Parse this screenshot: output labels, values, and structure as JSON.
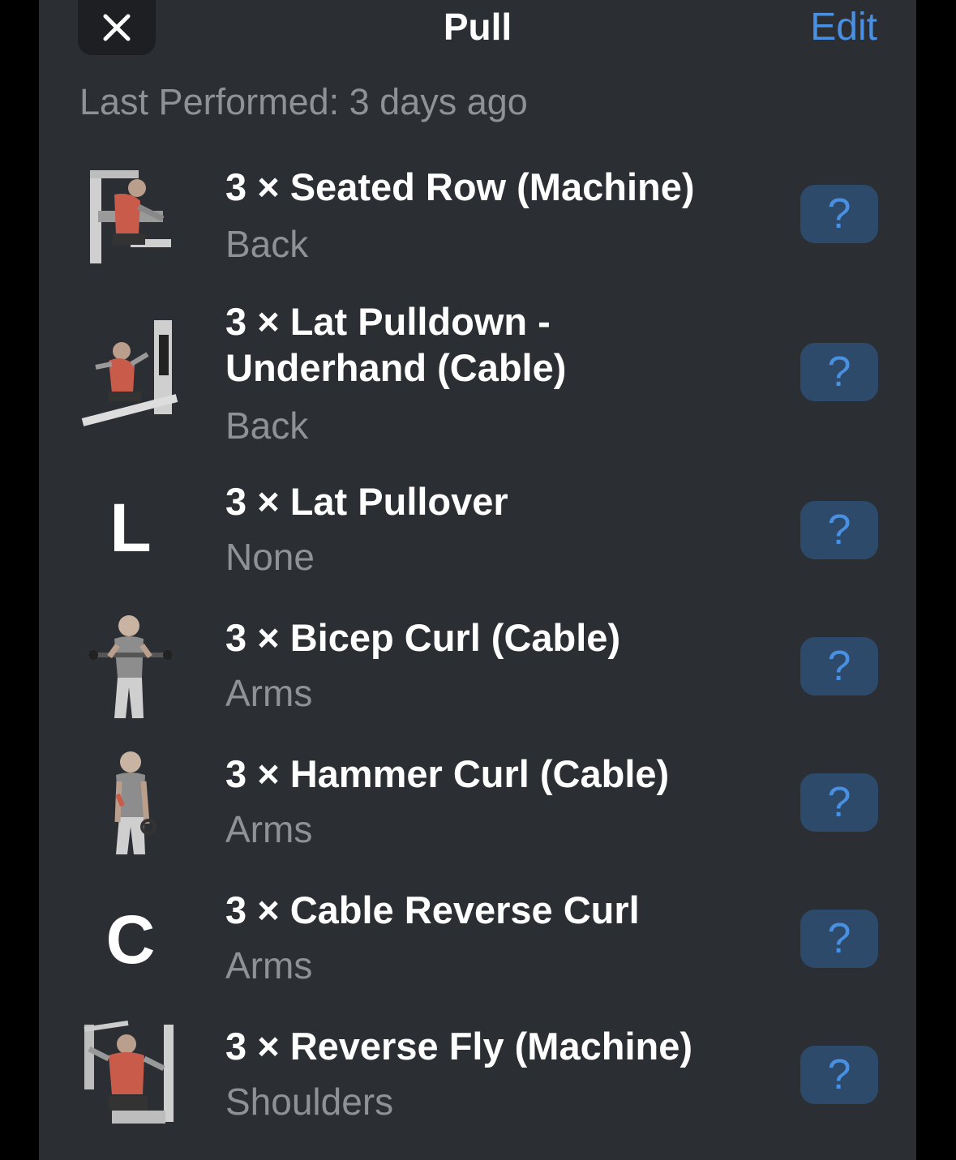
{
  "header": {
    "title": "Pull",
    "edit_label": "Edit",
    "close_icon": "close-icon"
  },
  "last_performed": "Last Performed: 3 days ago",
  "exercises": [
    {
      "name": "3 × Seated Row (Machine)",
      "muscle": "Back",
      "thumb": "image",
      "help": "?"
    },
    {
      "name": "3 × Lat Pulldown - Underhand (Cable)",
      "muscle": "Back",
      "thumb": "image",
      "help": "?"
    },
    {
      "name": "3 × Lat Pullover",
      "muscle": "None",
      "thumb": "L",
      "help": "?"
    },
    {
      "name": "3 × Bicep Curl (Cable)",
      "muscle": "Arms",
      "thumb": "image",
      "help": "?"
    },
    {
      "name": "3 × Hammer Curl (Cable)",
      "muscle": "Arms",
      "thumb": "image",
      "help": "?"
    },
    {
      "name": "3 × Cable Reverse Curl",
      "muscle": "Arms",
      "thumb": "C",
      "help": "?"
    },
    {
      "name": "3 × Reverse Fly (Machine)",
      "muscle": "Shoulders",
      "thumb": "image",
      "help": "?"
    }
  ],
  "colors": {
    "background": "#2b2e33",
    "accent": "#4a90e2",
    "secondary_text": "#8e9196",
    "help_button": "#2e4a6a"
  }
}
